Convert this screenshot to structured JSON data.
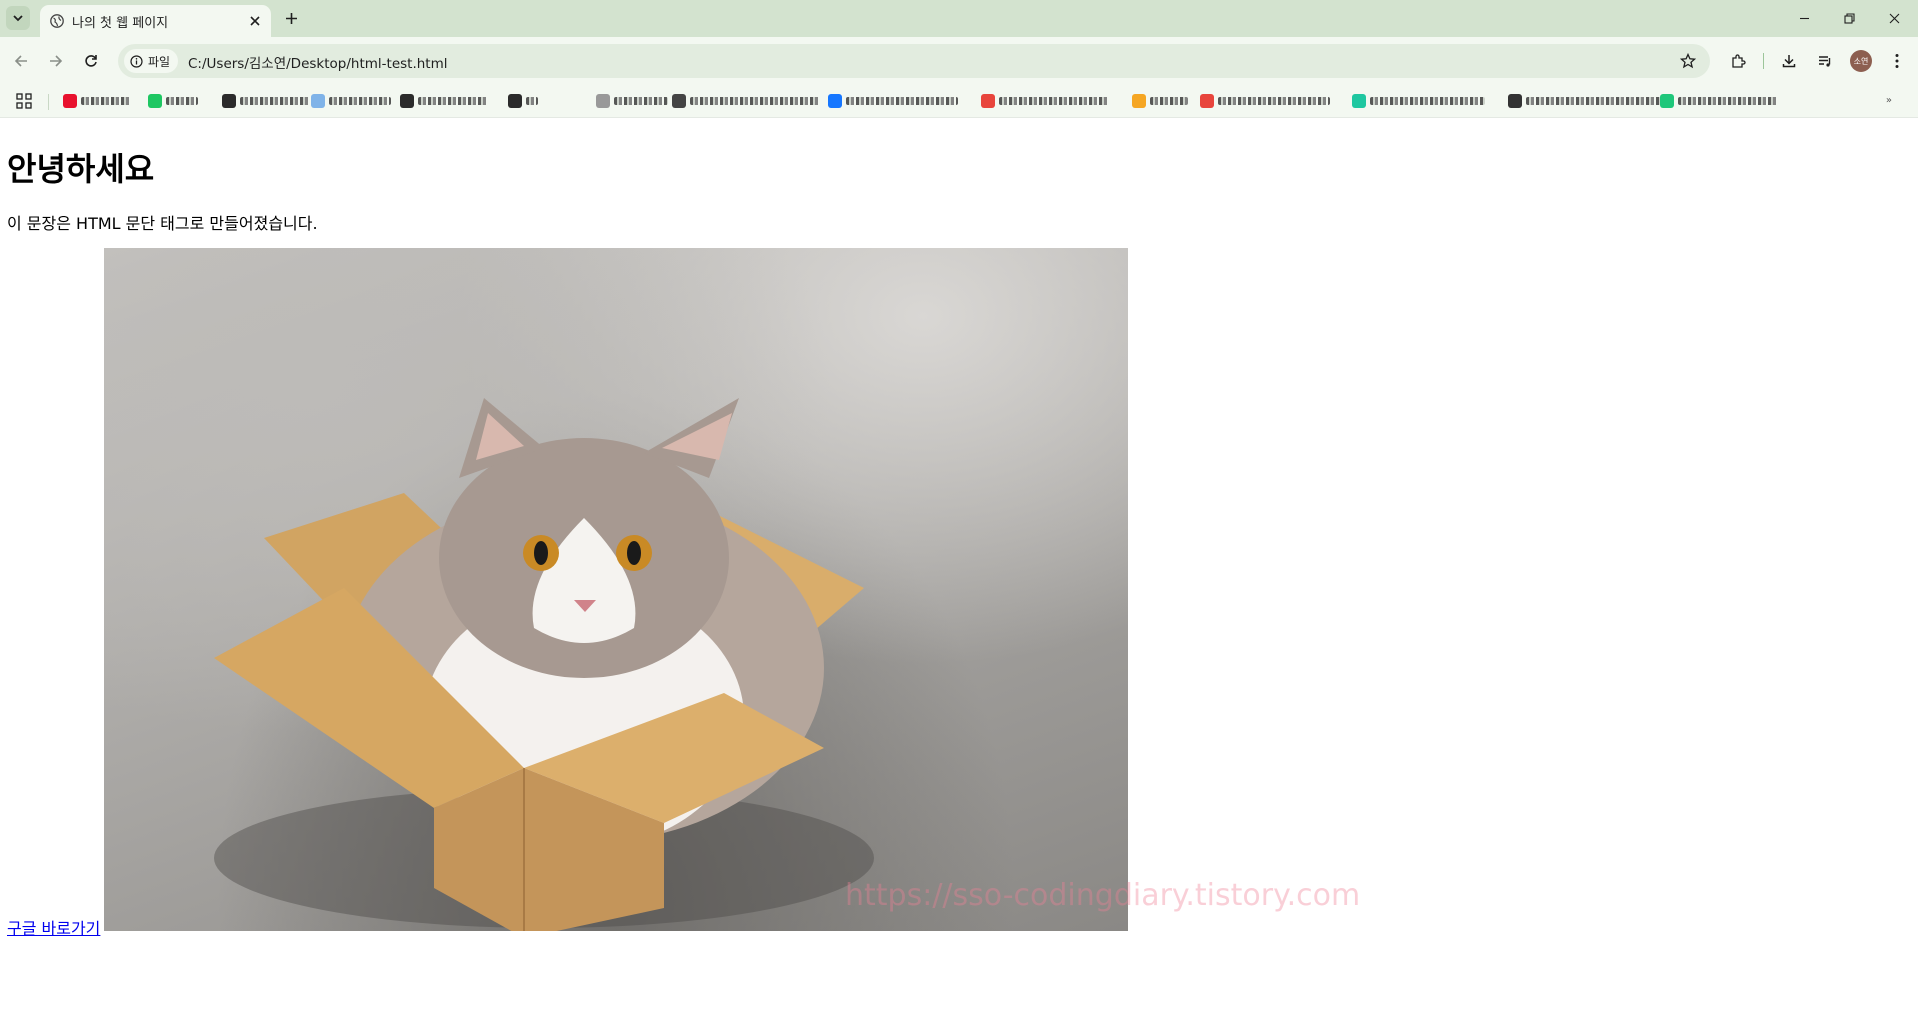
{
  "browser": {
    "tab_title": "나의 첫 웹 페이지",
    "address_chip": "파일",
    "url": "C:/Users/김소연/Desktop/html-test.html",
    "profile_initials": "소연"
  },
  "page": {
    "heading": "안녕하세요",
    "paragraph": "이 문장은 HTML 문단 태그로 만들어졌습니다.",
    "link_text": "구글 바로가기",
    "image_alt": "cat sitting in a cardboard box",
    "watermark": "https://sso-codingdiary.tistory.com"
  },
  "colors": {
    "tabstrip": "#d3e3cf",
    "toolbar": "#f3f8f1",
    "link": "#0000ee"
  },
  "icons": {
    "tab_search": "chevron-down-icon",
    "favicon": "globe-icon",
    "tab_close": "close-icon",
    "new_tab": "plus-icon",
    "back": "arrow-left-icon",
    "forward": "arrow-right-icon",
    "reload": "reload-icon",
    "info": "info-icon",
    "bookmark": "star-icon",
    "extensions": "puzzle-icon",
    "downloads": "download-icon",
    "media": "media-control-icon",
    "menu": "kebab-menu-icon",
    "apps": "apps-grid-icon"
  }
}
